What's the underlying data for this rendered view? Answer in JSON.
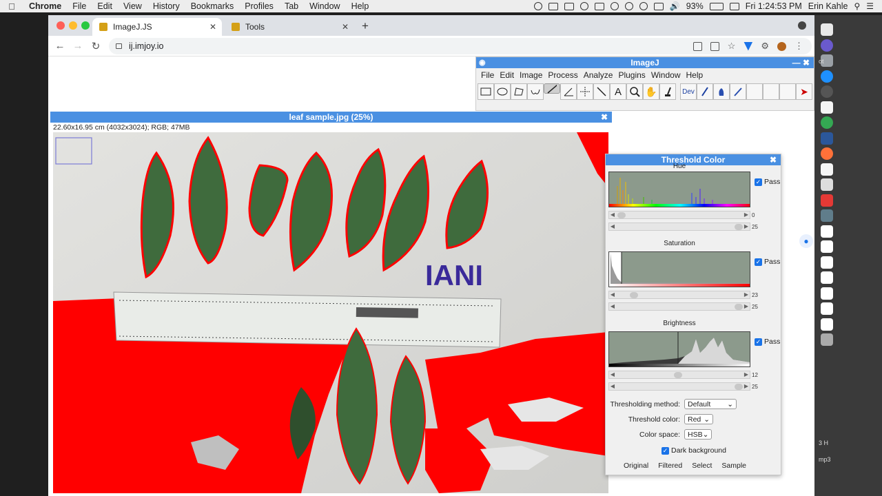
{
  "menubar": {
    "app": "Chrome",
    "items": [
      "File",
      "Edit",
      "View",
      "History",
      "Bookmarks",
      "Profiles",
      "Tab",
      "Window",
      "Help"
    ],
    "battery": "93%",
    "clock": "Fri 1:24:53 PM",
    "user": "Erin Kahle"
  },
  "browser": {
    "tabs": [
      {
        "title": "ImageJ.JS"
      },
      {
        "title": "Tools"
      }
    ],
    "url": "ij.imjoy.io"
  },
  "imagej": {
    "title": "ImageJ",
    "menu": [
      "File",
      "Edit",
      "Image",
      "Process",
      "Analyze",
      "Plugins",
      "Window",
      "Help"
    ],
    "dev_label": "Dev"
  },
  "image_window": {
    "title": "leaf sample.jpg (25%)",
    "info": "22.60x16.95 cm (4032x3024); RGB; 47MB",
    "annotation": "IANI"
  },
  "threshold": {
    "title": "Threshold Color",
    "hue_label": "Hue",
    "saturation_label": "Saturation",
    "brightness_label": "Brightness",
    "pass_label": "Pass",
    "hue_min_val": "0",
    "hue_max_val": "25",
    "sat_min_val": "23",
    "sat_max_val": "25",
    "bri_min_val": "12",
    "bri_max_val": "25",
    "method_label": "Thresholding method:",
    "method_value": "Default",
    "color_label": "Threshold color:",
    "color_value": "Red",
    "space_label": "Color space:",
    "space_value": "HSB",
    "dark_bg_label": "Dark background",
    "buttons": [
      "Original",
      "Filtered",
      "Select",
      "Sample"
    ]
  },
  "side": {
    "label1": "ot",
    "label2": "3 H",
    "label3": "mp3"
  }
}
